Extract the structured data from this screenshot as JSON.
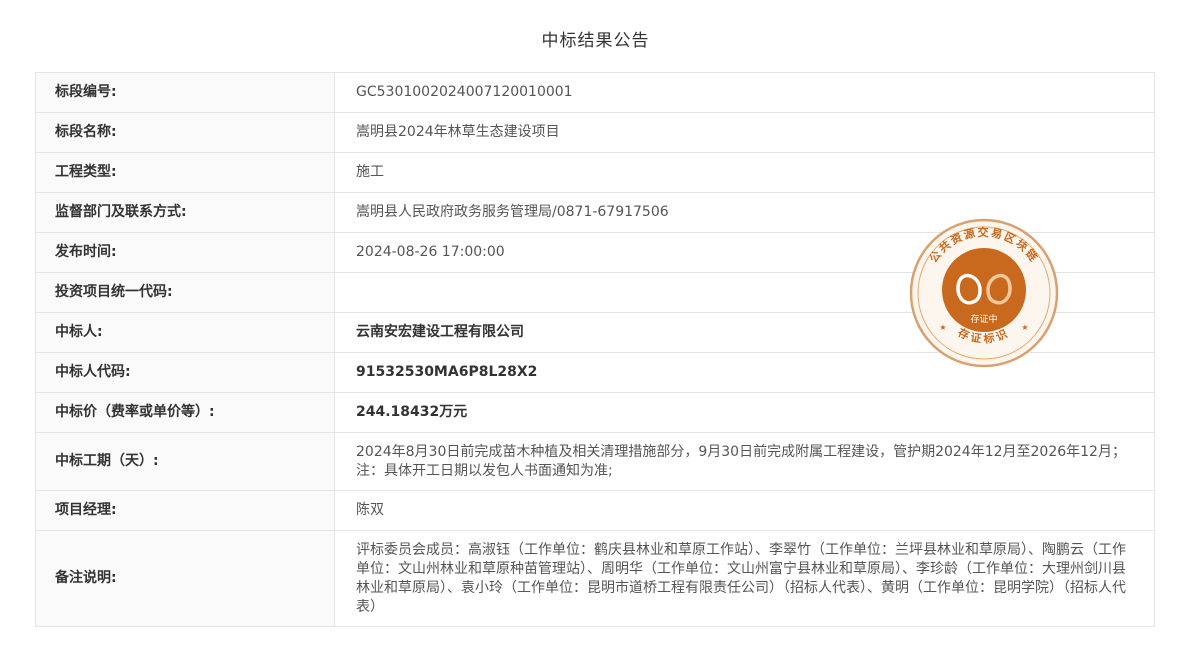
{
  "page": {
    "title": "中标结果公告"
  },
  "rows": [
    {
      "label": "标段编号:",
      "value": "GC5301002024007120010001"
    },
    {
      "label": "标段名称:",
      "value": "嵩明县2024年林草生态建设项目"
    },
    {
      "label": "工程类型:",
      "value": "施工"
    },
    {
      "label": "监督部门及联系方式:",
      "value": "嵩明县人民政府政务服务管理局/0871-67917506"
    },
    {
      "label": "发布时间:",
      "value": "2024-08-26 17:00:00"
    },
    {
      "label": "投资项目统一代码:",
      "value": ""
    },
    {
      "label": "中标人:",
      "value": "云南安宏建设工程有限公司"
    },
    {
      "label": "中标人代码:",
      "value": "91532530MA6P8L28X2"
    },
    {
      "label": "中标价（费率或单价等）:",
      "value": "244.18432万元"
    },
    {
      "label": "中标工期（天）:",
      "value": "2024年8月30日前完成苗木种植及相关清理措施部分，9月30日前完成附属工程建设，管护期2024年12月至2026年12月；注：具体开工日期以发包人书面通知为准;"
    },
    {
      "label": "项目经理:",
      "value": "陈双"
    },
    {
      "label": "备注说明:",
      "value": "评标委员会成员：高淑钰（工作单位：鹤庆县林业和草原工作站）、李翠竹（工作单位：兰坪县林业和草原局）、陶鹏云（工作单位：文山州林业和草原种苗管理站）、周明华（工作单位：文山州富宁县林业和草原局）、李珍龄（工作单位：大理州剑川县林业和草原局）、袁小玲（工作单位：昆明市道桥工程有限责任公司）（招标人代表）、黄明（工作单位：昆明学院）（招标人代表）"
    }
  ],
  "seal": {
    "ring_text": "公共资源交易区块链",
    "center_text": "存证中",
    "bottom_text": "存证标识",
    "colors": {
      "primary": "#c8691d",
      "light": "#e6a86b",
      "ring": "#d9a070"
    }
  }
}
